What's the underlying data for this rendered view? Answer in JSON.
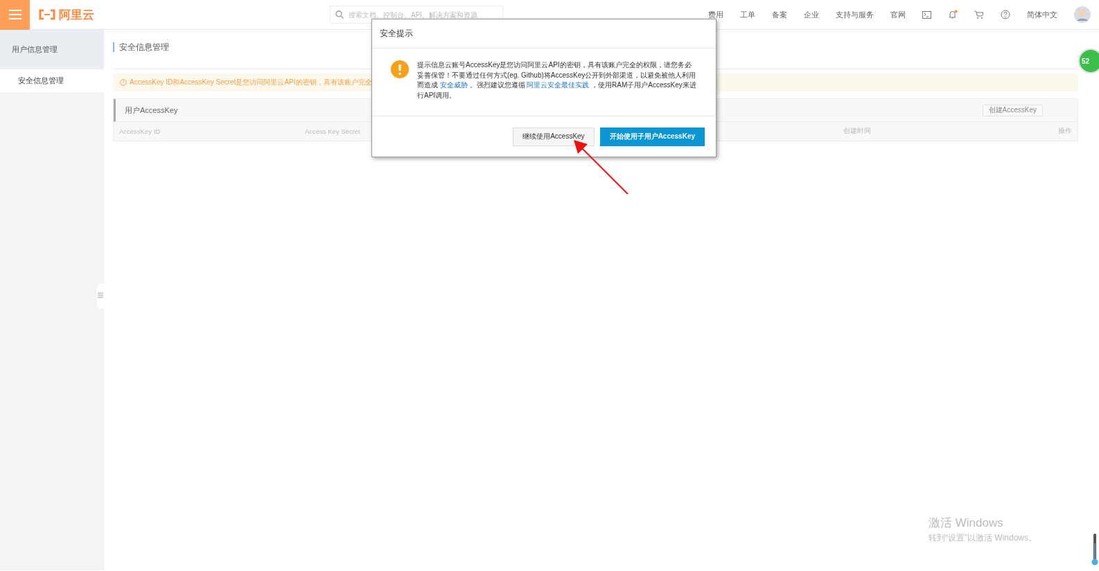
{
  "topbar": {
    "logo_text": "阿里云",
    "search": {
      "placeholder": "搜索文档、控制台、API、解决方案和资源"
    },
    "nav": [
      {
        "kind": "link",
        "label": "费用"
      },
      {
        "kind": "link",
        "label": "工单"
      },
      {
        "kind": "link",
        "label": "备案"
      },
      {
        "kind": "link",
        "label": "企业"
      },
      {
        "kind": "link",
        "label": "支持与服务"
      },
      {
        "kind": "link",
        "label": "官网"
      },
      {
        "kind": "terminal"
      },
      {
        "kind": "bell"
      },
      {
        "kind": "cart"
      },
      {
        "kind": "help"
      },
      {
        "kind": "link",
        "label": "简体中文"
      },
      {
        "kind": "avatar"
      }
    ]
  },
  "sidebar": {
    "heading": "用户信息管理",
    "items": [
      {
        "label": "安全信息管理",
        "selected": true
      }
    ]
  },
  "page_title": "安全信息管理",
  "notice": "AccessKey ID和AccessKey Secret是您访问阿里云API的密钥，具有该账户完全",
  "panel": {
    "title": "用户AccessKey",
    "create_button": "创建AccessKey",
    "columns": [
      {
        "label": "AccessKey ID"
      },
      {
        "label": "Access Key Secret"
      },
      {
        "label": "创建时间"
      },
      {
        "label": "操作"
      }
    ]
  },
  "modal": {
    "title": "安全提示",
    "message": [
      {
        "kind": "text",
        "text": "提示信息云账号AccessKey是您访问阿里云API的密钥，具有该账户完全的权限，请您务必妥善保管！不要通过任何方式(eg. Github)将AccessKey公开到外部渠道，以避免被他人利用而造成 "
      },
      {
        "kind": "link",
        "text": "安全威胁"
      },
      {
        "kind": "text",
        "text": " 。强烈建议您遵循 "
      },
      {
        "kind": "link",
        "text": "阿里云安全最佳实践"
      },
      {
        "kind": "text",
        "text": " ，使用RAM子用户AccessKey来进行API调用。"
      }
    ],
    "buttons": [
      {
        "label": "继续使用AccessKey",
        "primary": false
      },
      {
        "label": "开始使用子用户AccessKey",
        "primary": true
      }
    ]
  },
  "float_badge": "52",
  "windows_activation": {
    "title": "激活 Windows",
    "subtitle": "转到“设置”以激活 Windows。"
  }
}
